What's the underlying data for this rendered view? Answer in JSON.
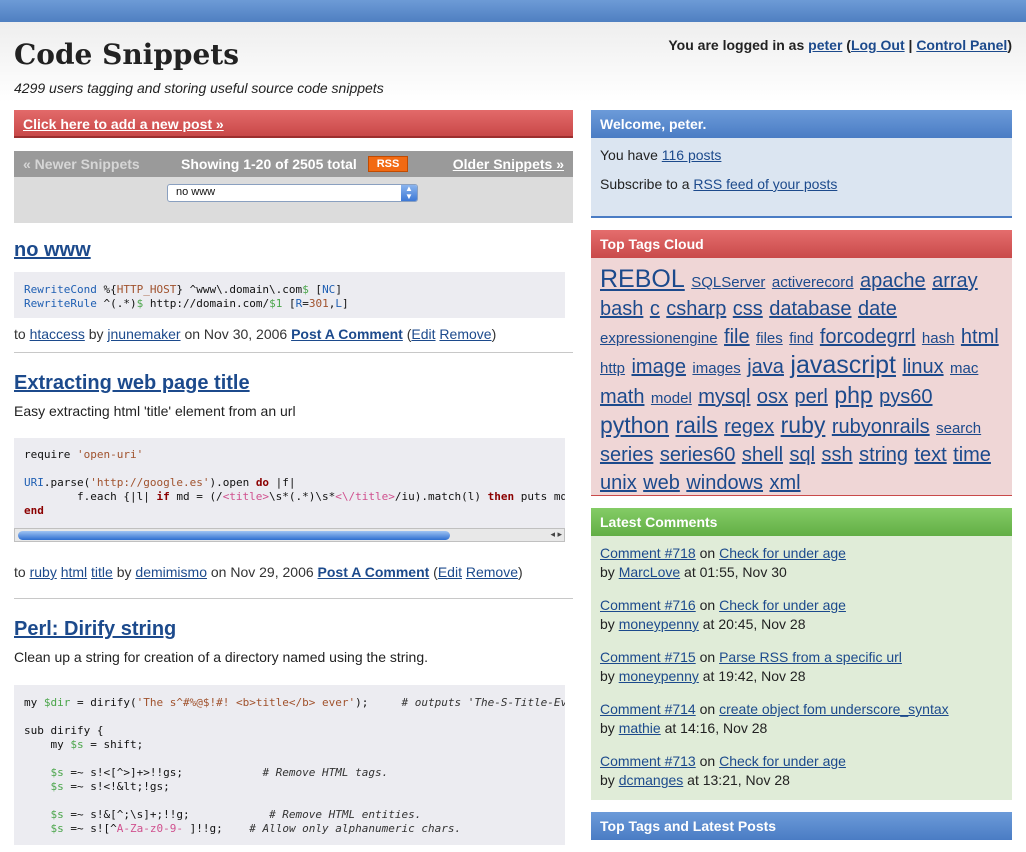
{
  "header": {
    "title": "Code Snippets",
    "tagline": "4299 users tagging and storing useful source code snippets",
    "logged_prefix": "You are logged in as",
    "username": "peter",
    "logout": "Log Out",
    "control_panel": "Control Panel"
  },
  "add_post": "Click here to add a new post »",
  "nav": {
    "newer": "« Newer Snippets",
    "showing": "Showing 1-20 of 2505 total",
    "rss": "RSS",
    "older": "Older Snippets »",
    "tag_filter": "no www"
  },
  "posts": [
    {
      "title": "no www",
      "tags": [
        "htaccess"
      ],
      "author": "jnunemaker",
      "date": "on Nov 30, 2006",
      "comment_label": "Post A Comment",
      "edit": "Edit",
      "remove": "Remove"
    },
    {
      "title": "Extracting web page title",
      "description": "Easy extracting html 'title' element from an url",
      "tags": [
        "ruby",
        "html",
        "title"
      ],
      "author": "demimismo",
      "date": "on Nov 29, 2006",
      "comment_label": "Post A Comment",
      "edit": "Edit",
      "remove": "Remove"
    },
    {
      "title": "Perl: Dirify string",
      "description": "Clean up a string for creation of a directory named using the string."
    }
  ],
  "sidebar": {
    "welcome": {
      "title": "Welcome, peter.",
      "you_have": "You have",
      "posts_link": "116 posts",
      "subscribe": "Subscribe to a",
      "rss_link": "RSS feed of your posts"
    },
    "tags_cloud": {
      "title": "Top Tags Cloud",
      "tags": [
        {
          "name": "REBOL",
          "size": 6
        },
        {
          "name": "SQLServer",
          "size": 2
        },
        {
          "name": "activerecord",
          "size": 2
        },
        {
          "name": "apache",
          "size": 4
        },
        {
          "name": "array",
          "size": 4
        },
        {
          "name": "bash",
          "size": 4
        },
        {
          "name": "c",
          "size": 4
        },
        {
          "name": "csharp",
          "size": 4
        },
        {
          "name": "css",
          "size": 4
        },
        {
          "name": "database",
          "size": 4
        },
        {
          "name": "date",
          "size": 4
        },
        {
          "name": "expressionengine",
          "size": 2
        },
        {
          "name": "file",
          "size": 4
        },
        {
          "name": "files",
          "size": 2
        },
        {
          "name": "find",
          "size": 2
        },
        {
          "name": "forcodegrrl",
          "size": 4
        },
        {
          "name": "hash",
          "size": 2
        },
        {
          "name": "html",
          "size": 4
        },
        {
          "name": "http",
          "size": 2
        },
        {
          "name": "image",
          "size": 4
        },
        {
          "name": "images",
          "size": 2
        },
        {
          "name": "java",
          "size": 4
        },
        {
          "name": "javascript",
          "size": 6
        },
        {
          "name": "linux",
          "size": 4
        },
        {
          "name": "mac",
          "size": 2
        },
        {
          "name": "math",
          "size": 4
        },
        {
          "name": "model",
          "size": 2
        },
        {
          "name": "mysql",
          "size": 4
        },
        {
          "name": "osx",
          "size": 4
        },
        {
          "name": "perl",
          "size": 4
        },
        {
          "name": "php",
          "size": 5
        },
        {
          "name": "pys60",
          "size": 4
        },
        {
          "name": "python",
          "size": 5
        },
        {
          "name": "rails",
          "size": 5
        },
        {
          "name": "regex",
          "size": 4
        },
        {
          "name": "ruby",
          "size": 5
        },
        {
          "name": "rubyonrails",
          "size": 4
        },
        {
          "name": "search",
          "size": 2
        },
        {
          "name": "series",
          "size": 4
        },
        {
          "name": "series60",
          "size": 4
        },
        {
          "name": "shell",
          "size": 4
        },
        {
          "name": "sql",
          "size": 4
        },
        {
          "name": "ssh",
          "size": 4
        },
        {
          "name": "string",
          "size": 4
        },
        {
          "name": "text",
          "size": 4
        },
        {
          "name": "time",
          "size": 4
        },
        {
          "name": "unix",
          "size": 4
        },
        {
          "name": "web",
          "size": 4
        },
        {
          "name": "windows",
          "size": 4
        },
        {
          "name": "xml",
          "size": 4
        }
      ]
    },
    "latest_comments": {
      "title": "Latest Comments",
      "items": [
        {
          "comment": "Comment #718",
          "on": "on",
          "post": "Check for under age",
          "by": "by",
          "user": "MarcLove",
          "time": "at 01:55, Nov 30"
        },
        {
          "comment": "Comment #716",
          "on": "on",
          "post": "Check for under age",
          "by": "by",
          "user": "moneypenny",
          "time": "at 20:45, Nov 28"
        },
        {
          "comment": "Comment #715",
          "on": "on",
          "post": "Parse RSS from a specific url",
          "by": "by",
          "user": "moneypenny",
          "time": "at 19:42, Nov 28"
        },
        {
          "comment": "Comment #714",
          "on": "on",
          "post": "create object fom underscore_syntax",
          "by": "by",
          "user": "mathie",
          "time": "at 14:16, Nov 28"
        },
        {
          "comment": "Comment #713",
          "on": "on",
          "post": "Check for under age",
          "by": "by",
          "user": "dcmanges",
          "time": "at 13:21, Nov 28"
        }
      ]
    },
    "top_tags_posts": {
      "title": "Top Tags and Latest Posts"
    }
  }
}
